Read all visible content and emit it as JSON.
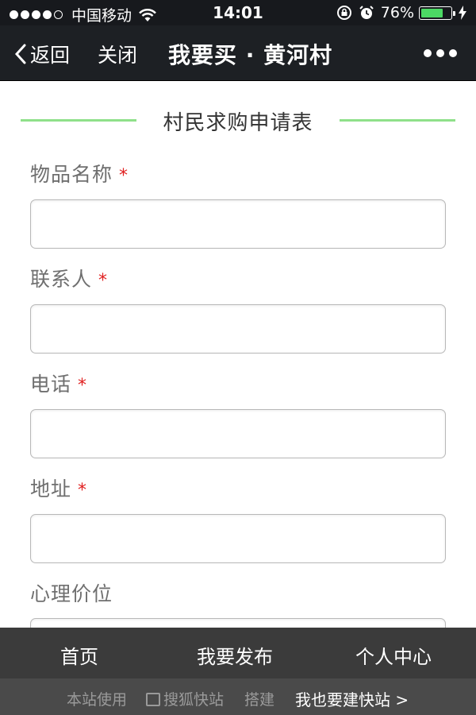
{
  "status_bar": {
    "carrier": "中国移动",
    "time": "14:01",
    "battery_percent": "76%",
    "battery_level": 0.76,
    "signal_bars_filled": 4,
    "signal_bars_total": 5
  },
  "nav_bar": {
    "back_label": "返回",
    "close_label": "关闭",
    "title": "我要买 · 黄河村",
    "more_icon": "ellipsis-icon"
  },
  "form": {
    "title": "村民求购申请表",
    "accent_color": "#8fe08a",
    "required_mark": "*",
    "fields": [
      {
        "label": "物品名称",
        "required": true,
        "value": ""
      },
      {
        "label": "联系人",
        "required": true,
        "value": ""
      },
      {
        "label": "电话",
        "required": true,
        "value": ""
      },
      {
        "label": "地址",
        "required": true,
        "value": ""
      },
      {
        "label": "心理价位",
        "required": false,
        "value": ""
      }
    ]
  },
  "bottom_nav": {
    "items": [
      "首页",
      "我要发布",
      "个人中心"
    ]
  },
  "footer": {
    "prefix": "本站使用",
    "brand": "搜狐快站",
    "suffix": "搭建",
    "link": "我也要建快站 >"
  }
}
